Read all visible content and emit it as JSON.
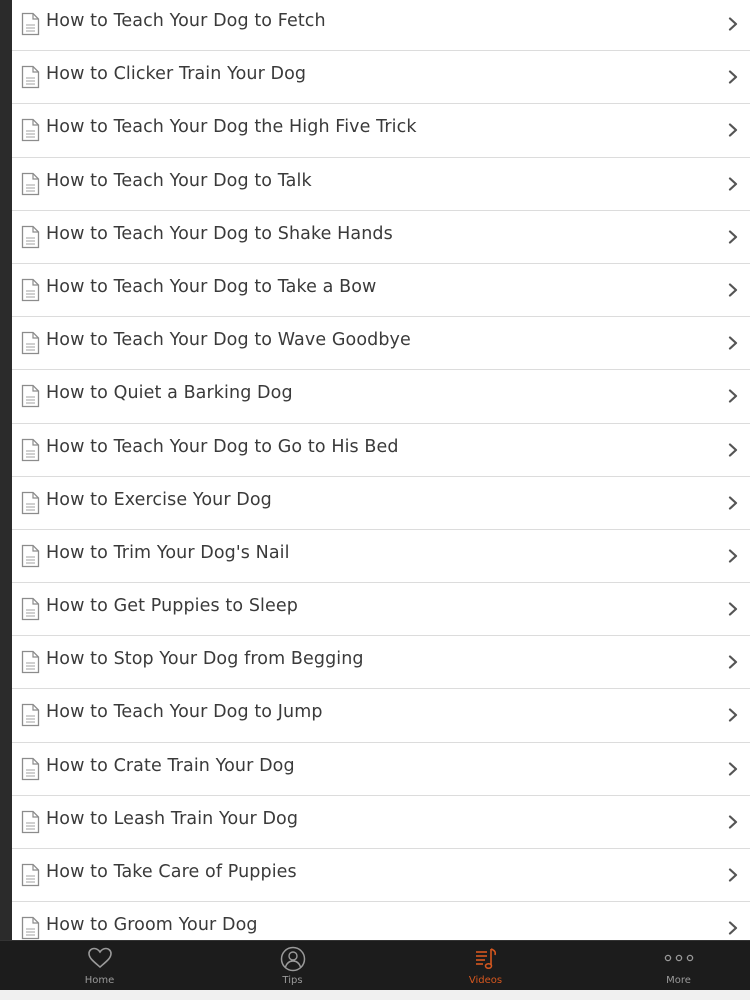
{
  "list": {
    "items": [
      {
        "label": "How to Teach Your Dog to Fetch"
      },
      {
        "label": "How to Clicker Train Your Dog"
      },
      {
        "label": "How to Teach Your Dog the High Five Trick"
      },
      {
        "label": "How to Teach Your Dog to Talk"
      },
      {
        "label": "How to Teach Your Dog to Shake Hands"
      },
      {
        "label": "How to Teach Your Dog to Take a Bow"
      },
      {
        "label": "How to Teach Your Dog to Wave Goodbye"
      },
      {
        "label": "How to Quiet a Barking Dog"
      },
      {
        "label": "How to Teach Your Dog to Go to His Bed"
      },
      {
        "label": "How to Exercise Your Dog"
      },
      {
        "label": "How to Trim Your Dog's Nail"
      },
      {
        "label": "How to Get Puppies to Sleep"
      },
      {
        "label": "How to Stop Your Dog from Begging"
      },
      {
        "label": "How to Teach Your Dog to Jump"
      },
      {
        "label": "How to Crate Train Your Dog"
      },
      {
        "label": "How to Leash Train Your Dog"
      },
      {
        "label": "How to Take Care of Puppies"
      },
      {
        "label": "How to Groom Your Dog"
      }
    ],
    "item_icon": "document-icon",
    "item_accessory": "chevron-right-icon"
  },
  "tabbar": {
    "tabs": [
      {
        "label": "Home",
        "icon": "heart-icon",
        "active": false
      },
      {
        "label": "Tips",
        "icon": "person-icon",
        "active": false
      },
      {
        "label": "Videos",
        "icon": "music-note-list-icon",
        "active": true
      },
      {
        "label": "More",
        "icon": "more-dots-icon",
        "active": false
      }
    ],
    "active_color": "#d5571f",
    "inactive_color": "#9a9a9a"
  }
}
